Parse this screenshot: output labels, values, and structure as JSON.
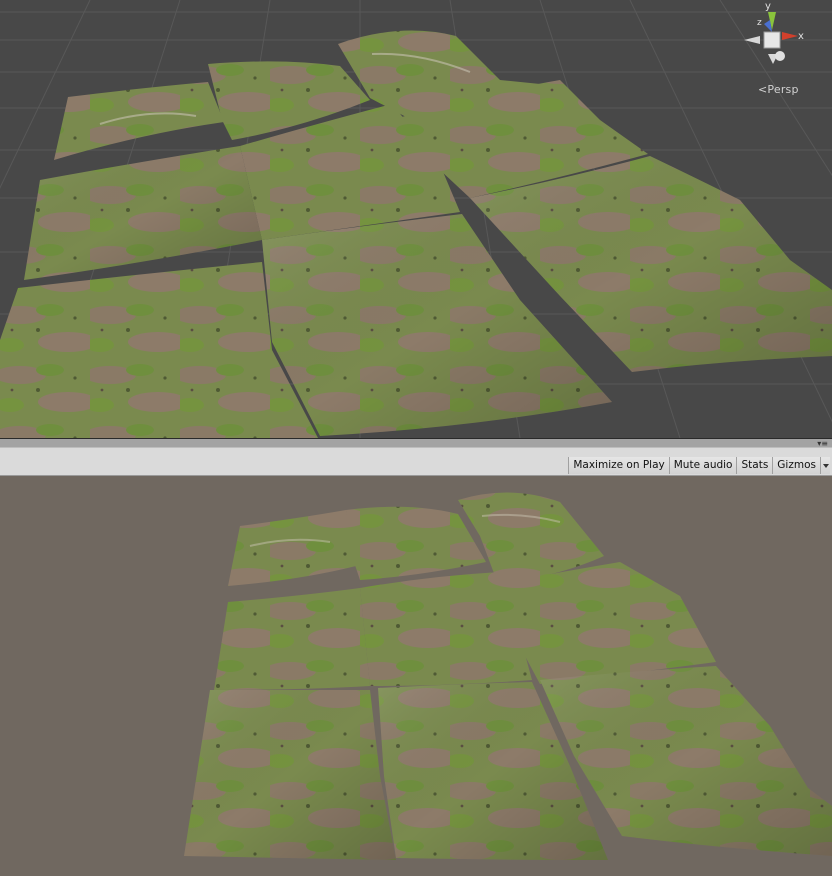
{
  "scene": {
    "view_mode_label": "Persp",
    "axes": {
      "x": "x",
      "y": "y",
      "z": "z"
    },
    "colors": {
      "background": "#484848",
      "grid": "#575757",
      "x_axis": "#d2402c",
      "y_axis": "#8ac43c",
      "z_axis": "#4a6fd0"
    }
  },
  "game_toolbar": {
    "maximize_label": "Maximize on Play",
    "mute_label": "Mute audio",
    "stats_label": "Stats",
    "gizmos_label": "Gizmos"
  },
  "game": {
    "colors": {
      "background": "#706860",
      "terrain_green": "#7a9446",
      "terrain_brown": "#8a7866"
    }
  }
}
